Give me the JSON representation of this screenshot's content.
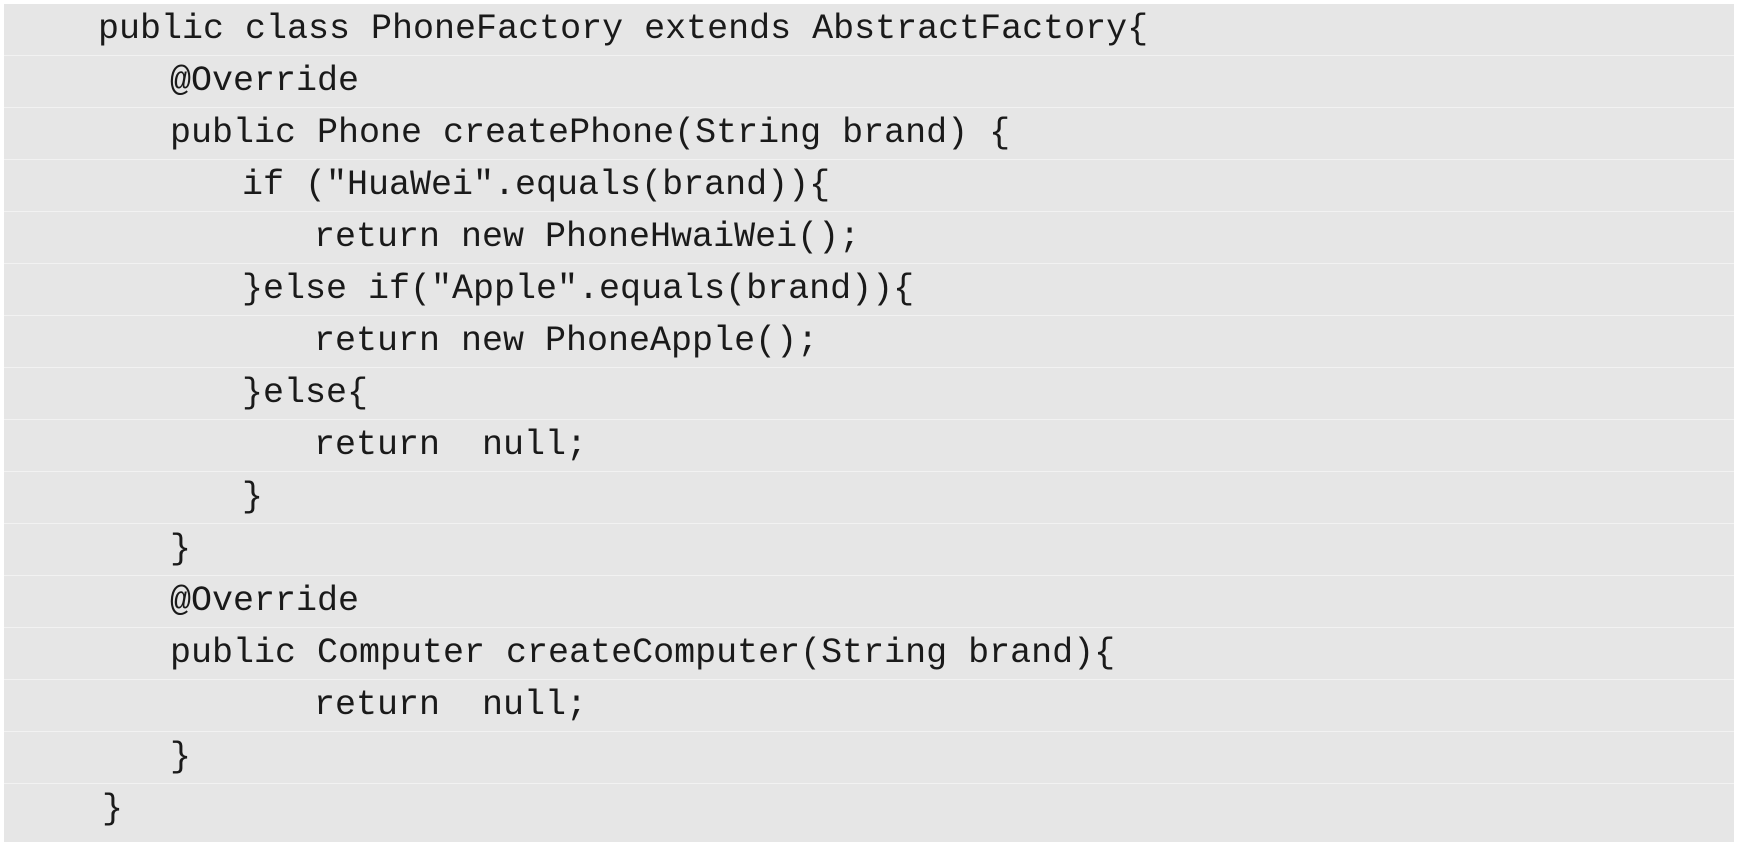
{
  "code": {
    "lines": [
      "public class PhoneFactory extends AbstractFactory{",
      "@Override",
      "public Phone createPhone(String brand) {",
      "if (\"HuaWei\".equals(brand)){",
      "return new PhoneHwaiWei();",
      "}else if(\"Apple\".equals(brand)){",
      "return new PhoneApple();",
      "}else{",
      "return  null;",
      "}",
      "}",
      "@Override",
      "public Computer createComputer(String brand){",
      "return  null;",
      "}",
      "}"
    ]
  }
}
